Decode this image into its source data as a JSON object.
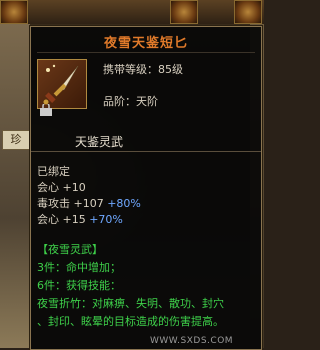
{
  "item": {
    "name": "夜雪天鉴短匕",
    "carry_level_label": "携带等级：85级",
    "rank_label": "品阶：天阶",
    "section_title": "天鉴灵武"
  },
  "side_tab": {
    "label": "珍"
  },
  "stats": {
    "bound": "已绑定",
    "lines": [
      {
        "base": "会心  +10",
        "extra": ""
      },
      {
        "base": "毒攻击  +107",
        "extra": "+80%"
      },
      {
        "base": "会心  +15",
        "extra": "+70%"
      }
    ]
  },
  "set": {
    "title": "【夜雪灵武】",
    "lines": [
      "3件：命中增加；",
      "6件：获得技能：",
      "夜雪折竹：对麻痹、失明、散功、封穴",
      "、封印、眩晕的目标造成的伤害提高。"
    ]
  },
  "watermark": "WWW.SXDS.COM",
  "colors": {
    "title": "#e07a2a",
    "extra": "#6fa8ff",
    "set_green": "#3ed04a"
  },
  "icons": [
    "dagger-icon",
    "lock-icon"
  ]
}
